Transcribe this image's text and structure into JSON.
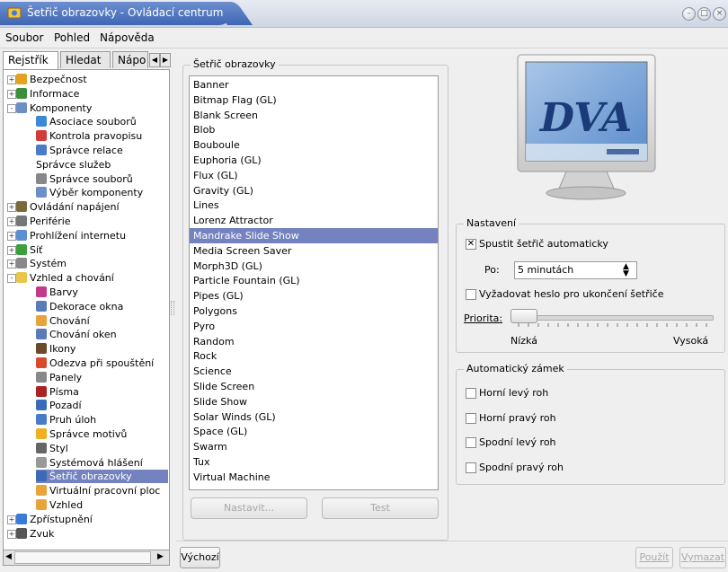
{
  "window": {
    "title": "Šetřič obrazovky - Ovládací centrum"
  },
  "menu": [
    "Soubor",
    "Pohled",
    "Nápověda"
  ],
  "left_tabs": [
    "Rejstřík",
    "Hledat",
    "Nápo"
  ],
  "tree": [
    {
      "label": "Bezpečnost",
      "level": 0,
      "exp": "+",
      "color": "#e2a321"
    },
    {
      "label": "Informace",
      "level": 0,
      "exp": "+",
      "color": "#3b8f3b"
    },
    {
      "label": "Komponenty",
      "level": 0,
      "exp": "-",
      "color": "#6c8fc8"
    },
    {
      "label": "Asociace souborů",
      "level": 1,
      "color": "#3b88d8"
    },
    {
      "label": "Kontrola pravopisu",
      "level": 1,
      "color": "#d33a3a"
    },
    {
      "label": "Správce relace",
      "level": 1,
      "color": "#4a7bc8"
    },
    {
      "label": "Správce služeb",
      "level": 1,
      "color": ""
    },
    {
      "label": "Správce souborů",
      "level": 1,
      "color": "#888888"
    },
    {
      "label": "Výběr komponenty",
      "level": 1,
      "color": "#6c8fc8"
    },
    {
      "label": "Ovládání napájení",
      "level": 0,
      "exp": "+",
      "color": "#7a6a3a"
    },
    {
      "label": "Periférie",
      "level": 0,
      "exp": "+",
      "color": "#777777"
    },
    {
      "label": "Prohlížení internetu",
      "level": 0,
      "exp": "+",
      "color": "#5a8fd0"
    },
    {
      "label": "Síť",
      "level": 0,
      "exp": "+",
      "color": "#3ba03b"
    },
    {
      "label": "Systém",
      "level": 0,
      "exp": "+",
      "color": "#888888"
    },
    {
      "label": "Vzhled a chování",
      "level": 0,
      "exp": "-",
      "color": "#e8c64a"
    },
    {
      "label": "Barvy",
      "level": 1,
      "color": "#c43a8a"
    },
    {
      "label": "Dekorace okna",
      "level": 1,
      "color": "#5a7ab8"
    },
    {
      "label": "Chování",
      "level": 1,
      "color": "#e8a43a"
    },
    {
      "label": "Chování oken",
      "level": 1,
      "color": "#5a7ab8"
    },
    {
      "label": "Ikony",
      "level": 1,
      "color": "#6a4a2a"
    },
    {
      "label": "Odezva při spouštění",
      "level": 1,
      "color": "#d84a2a"
    },
    {
      "label": "Panely",
      "level": 1,
      "color": "#888888"
    },
    {
      "label": "Písma",
      "level": 1,
      "color": "#aa2222"
    },
    {
      "label": "Pozadí",
      "level": 1,
      "color": "#3a6ab8"
    },
    {
      "label": "Pruh úloh",
      "level": 1,
      "color": "#4a7bc8"
    },
    {
      "label": "Správce motivů",
      "level": 1,
      "color": "#f0b020"
    },
    {
      "label": "Styl",
      "level": 1,
      "color": "#666666"
    },
    {
      "label": "Systémová hlášení",
      "level": 1,
      "color": "#999999"
    },
    {
      "label": "Šetřič obrazovky",
      "level": 1,
      "color": "#3a6ab8",
      "selected": true
    },
    {
      "label": "Virtuální pracovní ploc",
      "level": 1,
      "color": "#e8a43a"
    },
    {
      "label": "Vzhled",
      "level": 1,
      "color": "#e8a43a"
    },
    {
      "label": "Zpřístupnění",
      "level": 0,
      "exp": "+",
      "color": "#3a7ad8"
    },
    {
      "label": "Zvuk",
      "level": 0,
      "exp": "+",
      "color": "#555555"
    }
  ],
  "saver": {
    "group_title": "Šetřič obrazovky",
    "items": [
      "Banner",
      "Bitmap Flag (GL)",
      "Blank Screen",
      "Blob",
      "Bouboule",
      "Euphoria (GL)",
      "Flux (GL)",
      "Gravity (GL)",
      "Lines",
      "Lorenz Attractor",
      "Mandrake Slide Show",
      "Media Screen Saver",
      "Morph3D (GL)",
      "Particle Fountain (GL)",
      "Pipes (GL)",
      "Polygons",
      "Pyro",
      "Random",
      "Rock",
      "Science",
      "Slide Screen",
      "Slide Show",
      "Solar Winds (GL)",
      "Space (GL)",
      "Swarm",
      "Tux",
      "Virtual Machine"
    ],
    "selected": "Mandrake Slide Show",
    "setup_button": "Nastavit...",
    "test_button": "Test"
  },
  "settings": {
    "group_title": "Nastavení",
    "auto_start": "Spustit šetřič automaticky",
    "auto_start_checked": true,
    "after_label": "Po:",
    "after_value": "5 minutách",
    "require_password": "Vyžadovat heslo pro ukončení šetřiče",
    "require_password_checked": false,
    "priority_label": "Priorita:",
    "priority_low": "Nízká",
    "priority_high": "Vysoká",
    "priority_level": 0
  },
  "lock": {
    "group_title": "Automatický zámek",
    "options": [
      "Horní levý roh",
      "Horní pravý roh",
      "Spodní levý roh",
      "Spodní pravý roh"
    ]
  },
  "buttons": {
    "default": "Výchozí",
    "apply": "Použít",
    "reset": "Vymazat"
  },
  "preview": {
    "logo": "DVA"
  }
}
